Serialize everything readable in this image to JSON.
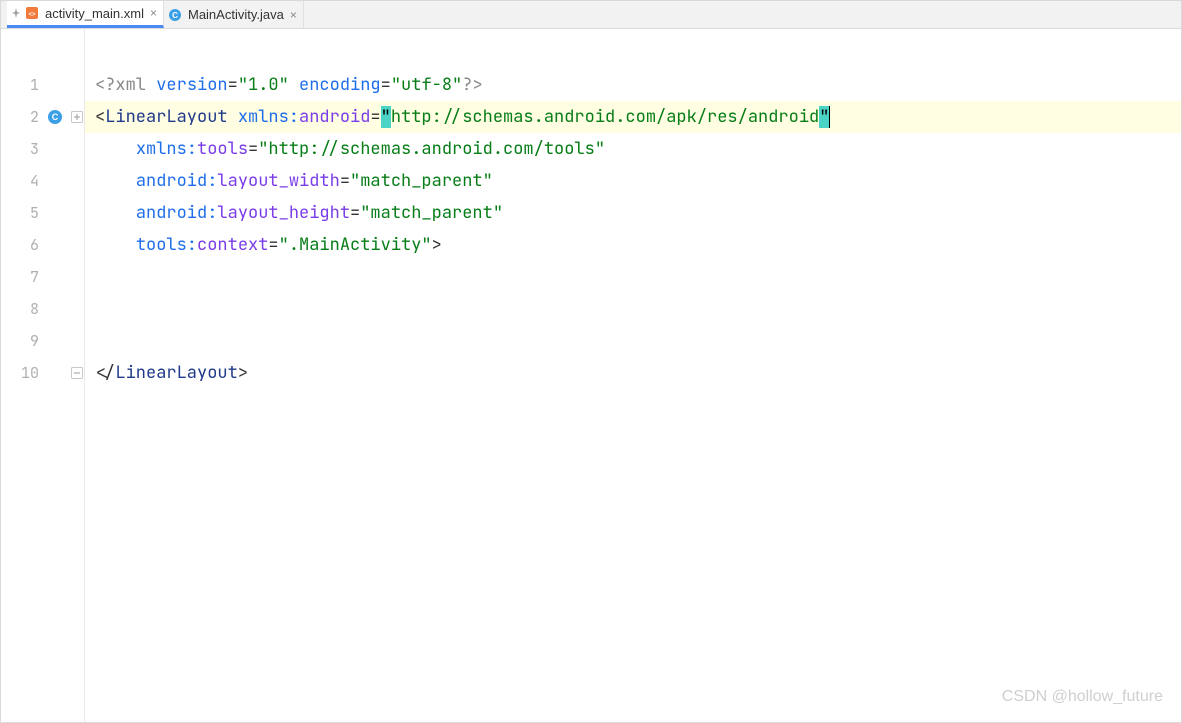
{
  "tabs": [
    {
      "label": "activity_main.xml",
      "active": true,
      "pinned": true,
      "kind": "xml"
    },
    {
      "label": "MainActivity.java",
      "active": false,
      "pinned": false,
      "kind": "java"
    }
  ],
  "gutter": {
    "lines": [
      "1",
      "2",
      "3",
      "4",
      "5",
      "6",
      "7",
      "8",
      "9",
      "10"
    ],
    "class_badge_line": 2
  },
  "code": {
    "l1": {
      "p_open": "<?",
      "xml": "xml ",
      "ver_attr": "version",
      "eq": "=",
      "ver_val": "\"1.0\"",
      "sp": " ",
      "enc_attr": "encoding",
      "enc_val": "\"utf-8\"",
      "p_close": "?>"
    },
    "l2": {
      "open": "<",
      "tag": "LinearLayout ",
      "ns": "xmlns:",
      "attr": "android",
      "eq": "=",
      "q": "\"",
      "val": "http://schemas.android.com/apk/res/android"
    },
    "l3": {
      "indent": "    ",
      "ns": "xmlns:",
      "attr": "tools",
      "eq": "=",
      "val": "\"http://schemas.android.com/tools\""
    },
    "l4": {
      "indent": "    ",
      "ns": "android:",
      "attr": "layout_width",
      "eq": "=",
      "val": "\"match_parent\""
    },
    "l5": {
      "indent": "    ",
      "ns": "android:",
      "attr": "layout_height",
      "eq": "=",
      "val": "\"match_parent\""
    },
    "l6": {
      "indent": "    ",
      "ns": "tools:",
      "attr": "context",
      "eq": "=",
      "val": "\".MainActivity\"",
      "close": ">"
    },
    "l10": {
      "open": "</",
      "tag": "LinearLayout",
      "close": ">"
    }
  },
  "watermark": "CSDN @hollow_future"
}
